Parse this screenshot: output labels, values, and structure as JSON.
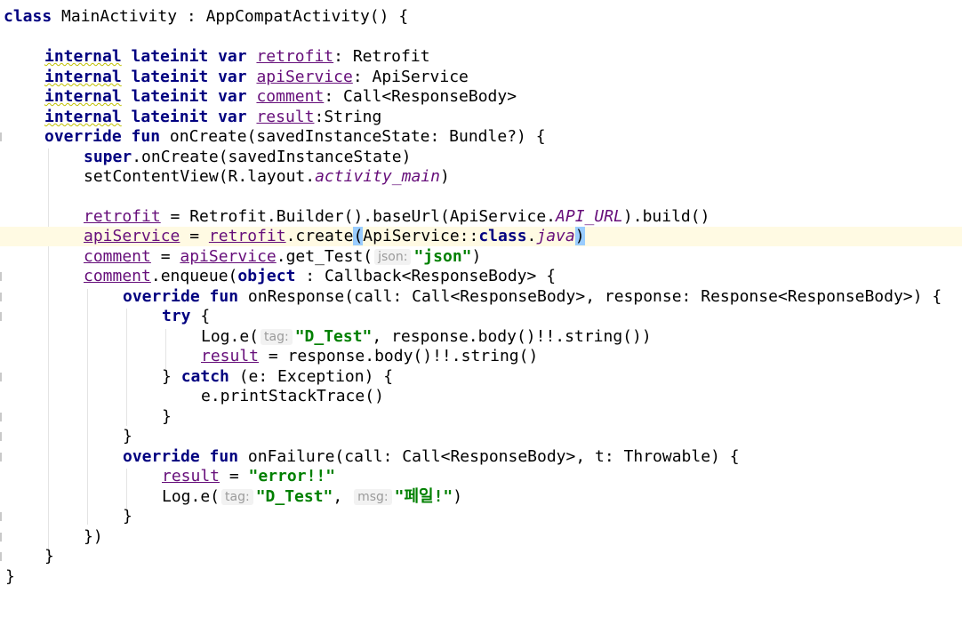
{
  "code": {
    "class_decl": "class MainActivity : AppCompatActivity() {",
    "kw_internal": "internal",
    "kw_lateinit": "lateinit",
    "kw_var": "var",
    "kw_override": "override",
    "kw_fun": "fun",
    "kw_super": "super",
    "kw_object": "object",
    "kw_try": "try",
    "kw_catch": "catch",
    "kw_class": "class",
    "prop_retrofit": "retrofit",
    "prop_apiService": "apiService",
    "prop_comment": "comment",
    "prop_result": "result",
    "type_retrofit": ": Retrofit",
    "type_apiService": ": ApiService",
    "type_comment": ": Call<ResponseBody>",
    "type_result": ":String",
    "oncreate_sig": " onCreate(savedInstanceState: Bundle?) {",
    "super_call": ".onCreate(savedInstanceState)",
    "setcontent_pre": "setContentView(R.layout.",
    "setcontent_res": "activity_main",
    "setcontent_post": ")",
    "retrofit_pre": " = Retrofit.Builder().baseUrl(ApiService.",
    "api_url": "API_URL",
    "retrofit_post": ").build()",
    "eq": " = ",
    "create_pre": ".create",
    "create_open": "(",
    "create_mid": "ApiService::",
    "create_java": "java",
    "create_close": ")",
    "dot": ".",
    "get_test": ".get_Test(",
    "hint_json": "json:",
    "str_json": "\"json\"",
    "close_paren": ")",
    "enqueue_pre": ".enqueue(",
    "enqueue_post": " : Callback<ResponseBody> {",
    "onresponse_sig": " onResponse(call: Call<ResponseBody>, response: Response<ResponseBody>) {",
    "open_brace": " {",
    "loge": "Log.e(",
    "hint_tag": "tag:",
    "hint_msg": "msg:",
    "str_dtest": "\"D_Test\"",
    "loge_body": ", response.body()!!.string())",
    "result_body": " = response.body()!!.string()",
    "catch_pre": "} ",
    "catch_post": " (e: Exception) {",
    "print_stack": "e.printStackTrace()",
    "rbrace": "}",
    "onfailure_sig": " onFailure(call: Call<ResponseBody>, t: Throwable) {",
    "str_error": "\"error!!\"",
    "comma": ", ",
    "str_fail": "\"페일!\"",
    "close_obj": "})"
  },
  "colors": {
    "keyword": "#000080",
    "string": "#008000",
    "property": "#660e7a",
    "hint_text": "#9b9b9b",
    "current_line": "#fffae3",
    "brace_highlight": "#99ccff"
  }
}
